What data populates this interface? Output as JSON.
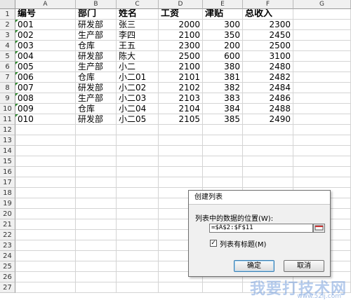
{
  "columns": [
    "A",
    "B",
    "C",
    "D",
    "E",
    "F",
    "G"
  ],
  "row_numbers": [
    "1",
    "2",
    "3",
    "4",
    "5",
    "6",
    "7",
    "8",
    "9",
    "10",
    "11",
    "12",
    "13",
    "14",
    "15",
    "16",
    "17",
    "18",
    "19",
    "20",
    "21",
    "22",
    "23",
    "24",
    "25",
    "26",
    "27"
  ],
  "header_row": [
    "编号",
    "部门",
    "姓名",
    "工资",
    "津贴",
    "总收入"
  ],
  "rows": [
    [
      "001",
      "研发部",
      "张三",
      "2000",
      "300",
      "2300"
    ],
    [
      "002",
      "生产部",
      "李四",
      "2100",
      "350",
      "2450"
    ],
    [
      "003",
      "仓库",
      "王五",
      "2300",
      "200",
      "2500"
    ],
    [
      "004",
      "研发部",
      "陈大",
      "2500",
      "600",
      "3100"
    ],
    [
      "005",
      "生产部",
      "小二",
      "2100",
      "380",
      "2480"
    ],
    [
      "006",
      "仓库",
      "小二01",
      "2101",
      "381",
      "2482"
    ],
    [
      "007",
      "研发部",
      "小二02",
      "2102",
      "382",
      "2484"
    ],
    [
      "008",
      "生产部",
      "小二03",
      "2103",
      "383",
      "2486"
    ],
    [
      "009",
      "仓库",
      "小二04",
      "2104",
      "384",
      "2488"
    ],
    [
      "010",
      "研发部",
      "小二05",
      "2105",
      "385",
      "2490"
    ]
  ],
  "dialog": {
    "title": "创建列表",
    "range_label": "列表中的数据的位置(W):",
    "range_value": "=$A$2:$F$11",
    "has_headers_label": "列表有标题(M)",
    "has_headers_checked": true,
    "ok_label": "确定",
    "cancel_label": "取消"
  },
  "watermark": {
    "text": "我要打技术网",
    "url": "www.52ij.com"
  },
  "colors": {
    "header_bg": "#f0f0f0",
    "grid": "#d4d4d4",
    "error_triangle": "#2e8b2e",
    "ok_border": "#3c7fb1"
  }
}
